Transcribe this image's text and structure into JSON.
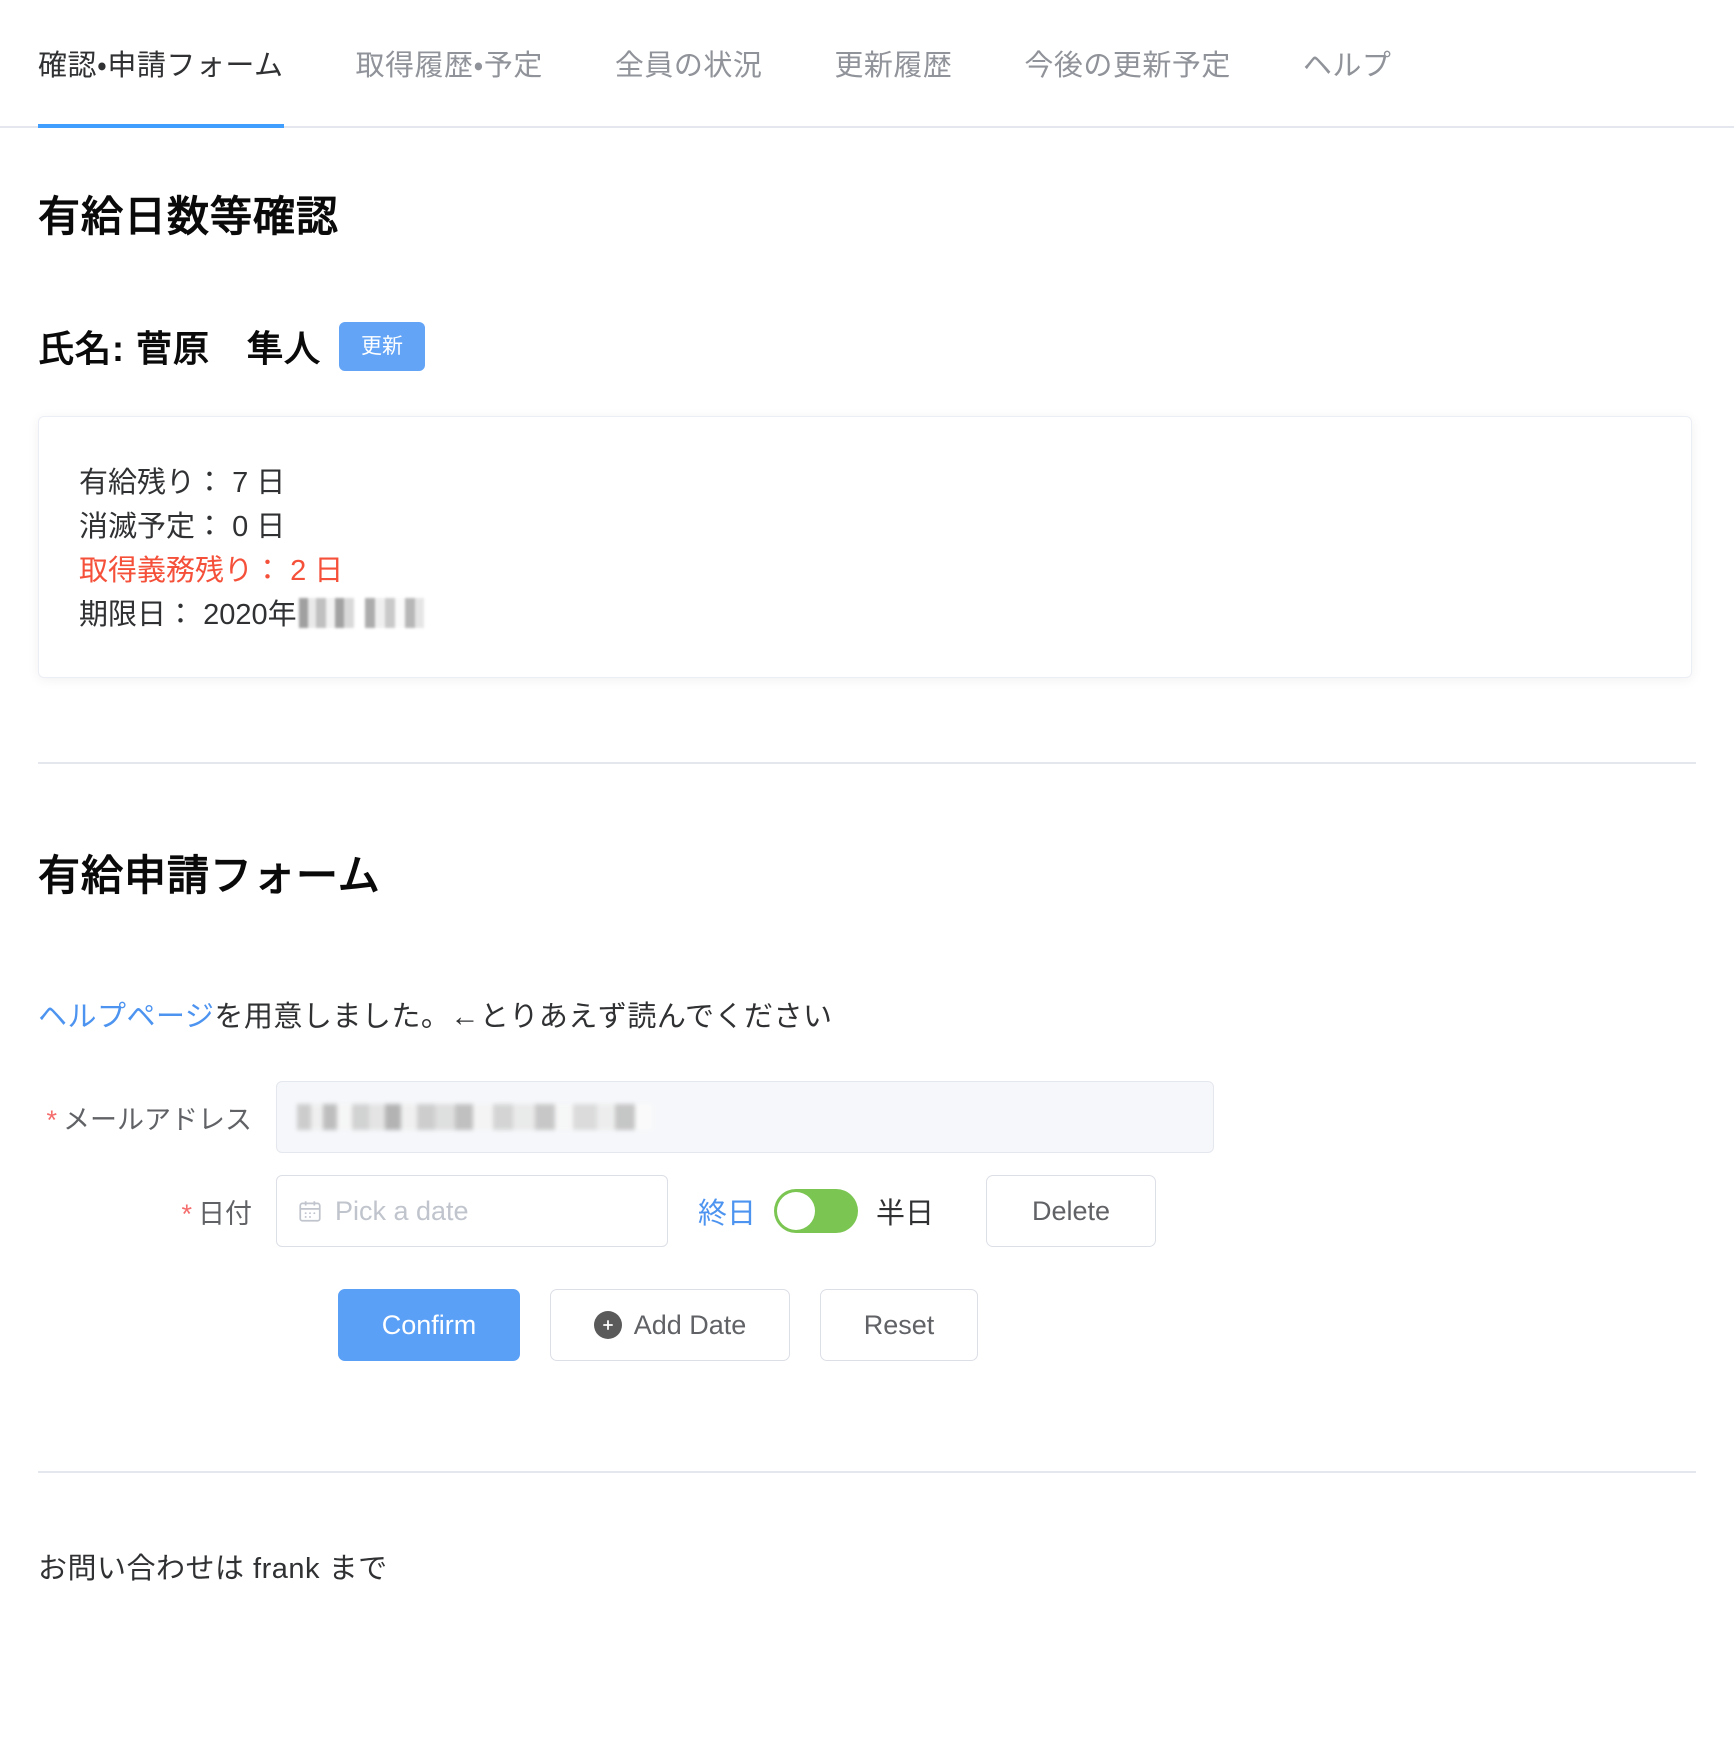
{
  "tabs": [
    {
      "label": "確認・申請フォーム",
      "active": true
    },
    {
      "label": "取得履歴・予定",
      "active": false
    },
    {
      "label": "全員の状況",
      "active": false
    },
    {
      "label": "更新履歴",
      "active": false
    },
    {
      "label": "今後の更新予定",
      "active": false
    },
    {
      "label": "ヘルプ",
      "active": false
    }
  ],
  "status_section": {
    "heading": "有給日数等確認",
    "name_label": "氏名:",
    "name_value": "菅原　隼人",
    "update_button": "更新",
    "card": {
      "remaining": {
        "label": "有給残り：",
        "value": "7",
        "unit": "日"
      },
      "expiring": {
        "label": "消滅予定：",
        "value": "0",
        "unit": "日"
      },
      "obligation": {
        "label": "取得義務残り：",
        "value": "2",
        "unit": "日",
        "color": "#f5503a"
      },
      "deadline": {
        "label": "期限日：",
        "value": "2020年",
        "redacted": true
      }
    }
  },
  "form_section": {
    "heading": "有給申請フォーム",
    "help_link": "ヘルプページ",
    "help_text": "を用意しました。←とりあえず読んでください",
    "email_field": {
      "label": "メールアドレス",
      "required_mark": "*",
      "value": "",
      "disabled": true,
      "redacted": true
    },
    "date_field": {
      "label": "日付",
      "required_mark": "*",
      "value": "",
      "placeholder": "Pick a date",
      "icon": "calendar-icon"
    },
    "day_type_toggle": {
      "left_label": "終日",
      "right_label": "半日",
      "state": "left",
      "color": "#7bc552"
    },
    "delete_button": "Delete",
    "actions": {
      "confirm": "Confirm",
      "add_date": "Add Date",
      "add_date_icon": "plus-circle-icon",
      "reset": "Reset"
    }
  },
  "footer": {
    "text": "お問い合わせは frank まで"
  },
  "theme": {
    "accent": "#409eff",
    "primary_button": "#5aa0f7",
    "danger": "#f5503a",
    "switch_on": "#7bc552",
    "border": "#dcdfe6"
  }
}
